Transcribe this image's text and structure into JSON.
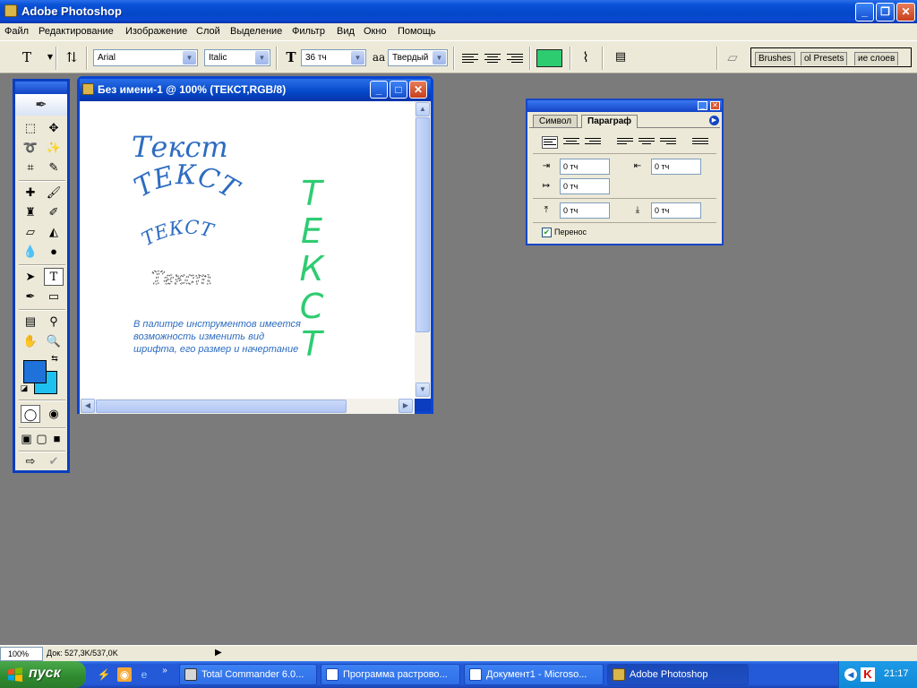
{
  "app": {
    "title": "Adobe Photoshop"
  },
  "window_controls": {
    "minimize": "_",
    "maximize": "❐",
    "close": "✕"
  },
  "menu": [
    "Файл",
    "Редактирование",
    "Изображение",
    "Слой",
    "Выделение",
    "Фильтр",
    "Вид",
    "Окно",
    "Помощь"
  ],
  "options": {
    "font_family": "Arial",
    "font_style": "Italic",
    "font_size": "36 тч",
    "antialias_icon": "aa",
    "antialias": "Твердый",
    "text_color": "#2ecc71",
    "palette_tabs": [
      "Brushes",
      "ol Presets",
      "ие слоев"
    ]
  },
  "document": {
    "title": "Без имени-1 @ 100% (ТЕКСТ,RGB/8)",
    "texts": {
      "heading": "Текст",
      "arc_upper": "ТЕКСТ",
      "arc_lower": "ТЕКСТ",
      "selected": "Текст",
      "vertical": [
        "Т",
        "Е",
        "К",
        "С",
        "Т"
      ],
      "note": "В палитре инструментов имеется возможность изменить вид  шрифта, его размер и начертание"
    },
    "colors": {
      "blue_text": "#2d6cc0",
      "green_text": "#2ecc71"
    }
  },
  "toolbox": {
    "foreground_color": "#1e72d9",
    "background_color": "#1ec0f0"
  },
  "paragraph_palette": {
    "tabs": [
      "Символ",
      "Параграф"
    ],
    "active_tab": "Параграф",
    "indent_left": "0 тч",
    "indent_right": "0 тч",
    "indent_first": "0 тч",
    "space_before": "0 тч",
    "space_after": "0 тч",
    "hyphenate_label": "Перенос",
    "hyphenate_checked": true
  },
  "status": {
    "zoom": "100%",
    "doc_info": "Док: 527,3K/537,0K"
  },
  "taskbar": {
    "start_label": "пуск",
    "quick_launch_more": "»",
    "tasks": [
      {
        "label": "Total Commander 6.0...",
        "active": false
      },
      {
        "label": "Программа растрово...",
        "active": false
      },
      {
        "label": "Документ1 - Microso...",
        "active": false
      },
      {
        "label": "Adobe Photoshop",
        "active": true
      }
    ],
    "clock": "21:17"
  }
}
